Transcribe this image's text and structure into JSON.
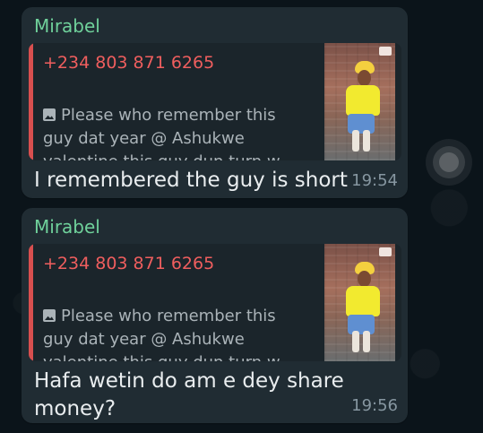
{
  "conversation": {
    "messages": [
      {
        "sender": "Mirabel",
        "quote": {
          "phone": "+234 803 871 6265",
          "text": "Please who remember this\nguy dat year @ Ashukwe\nvalentine this guy dun turn w..."
        },
        "body": "I remembered the guy is short",
        "time": "19:54"
      },
      {
        "sender": "Mirabel",
        "quote": {
          "phone": "+234 803 871 6265",
          "text": "Please who remember this\nguy dat year @ Ashukwe\nvalentine this guy dun turn w..."
        },
        "body": "Hafa wetin do am e dey share money?",
        "time": "19:56"
      }
    ]
  },
  "icons": {
    "quote_media": "photo-icon",
    "scroll": "scroll-to-bottom-icon"
  },
  "colors": {
    "background": "#0b141a",
    "bubble": "#202c33",
    "quote_background": "#1b252b",
    "sender_name": "#6fd19b",
    "quote_phone": "#ef5e5e",
    "quote_bar": "#d84f4f",
    "body_text": "#e9edef",
    "secondary_text": "#8696a0"
  }
}
